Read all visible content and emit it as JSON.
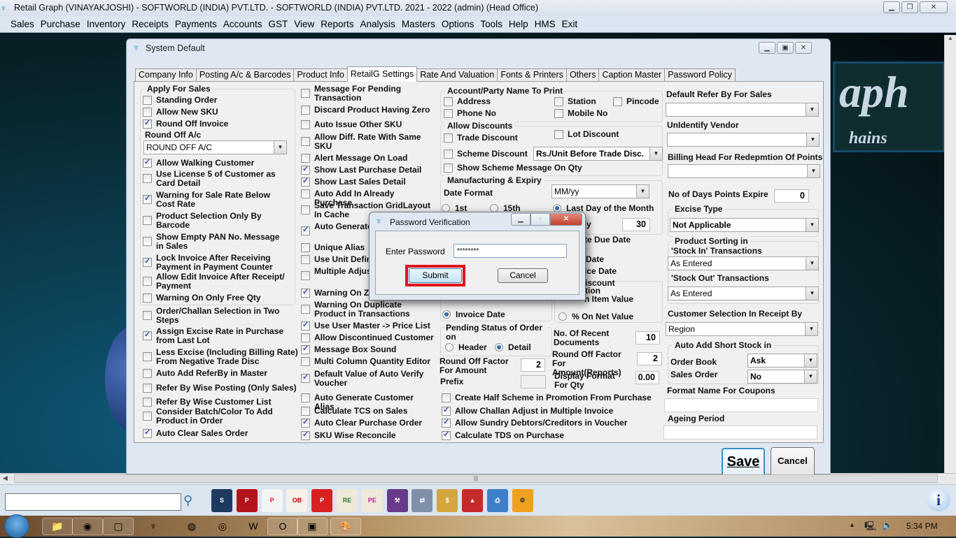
{
  "app": {
    "title": "Retail Graph (VINAYAKJOSHI) - SOFTWORLD (INDIA) PVT.LTD. - SOFTWORLD (INDIA) PVT.LTD.  2021 - 2022 (admin) (Head Office)"
  },
  "menu": [
    "Sales",
    "Purchase",
    "Inventory",
    "Receipts",
    "Payments",
    "Accounts",
    "GST",
    "View",
    "Reports",
    "Analysis",
    "Masters",
    "Options",
    "Tools",
    "Help",
    "HMS",
    "Exit"
  ],
  "background_logo": {
    "line1": "aph",
    "line2": "hains"
  },
  "window": {
    "title": "System Default",
    "tabs": [
      "Company Info",
      "Posting A/c & Barcodes",
      "Product Info",
      "RetailG Settings",
      "Rate And Valuation",
      "Fonts & Printers",
      "Others",
      "Caption Master",
      "Password Policy"
    ],
    "active_tab": "RetailG Settings"
  },
  "col1": {
    "group_title": "Apply For Sales",
    "items": [
      {
        "label": "Standing Order",
        "checked": false
      },
      {
        "label": "Allow New SKU",
        "checked": false
      },
      {
        "label": "Round Off Invoice",
        "checked": true
      }
    ],
    "round_off_label": "Round Off A/c",
    "round_off_value": "ROUND OFF A/C",
    "items2": [
      {
        "label": "Allow Walking Customer",
        "checked": true
      },
      {
        "label": "Use License 5 of Customer as Card Detail",
        "checked": false
      },
      {
        "label": "Warning for Sale Rate Below Cost Rate",
        "checked": true
      },
      {
        "label": "Product Selection Only By Barcode",
        "checked": false
      },
      {
        "label": "Show Empty PAN No. Message in Sales",
        "checked": false
      },
      {
        "label": "Lock Invoice After Receiving Payment in Payment Counter",
        "checked": true
      },
      {
        "label": "Allow Edit Invoice After Receipt/ Payment",
        "checked": false
      },
      {
        "label": "Warning On Only Free Qty",
        "checked": false
      }
    ],
    "items3": [
      {
        "label": "Order/Challan Selection in Two Steps",
        "checked": false
      },
      {
        "label": "Assign Excise Rate in Purchase from Last Lot",
        "checked": true
      },
      {
        "label": "Less Excise (Including Billing Rate) From Negative Trade Disc",
        "checked": false
      },
      {
        "label": "Auto Add ReferBy in Master",
        "checked": false
      },
      {
        "label": "Refer By Wise Posting (Only Sales)",
        "checked": false
      },
      {
        "label": "Refer By Wise Customer List",
        "checked": false
      },
      {
        "label": "Consider Batch/Color To Add Product in Order",
        "checked": false
      },
      {
        "label": "Auto Clear Sales Order",
        "checked": true
      }
    ]
  },
  "col2": {
    "items": [
      {
        "label": "Message For Pending Transaction",
        "checked": false
      },
      {
        "label": "Discard Product Having Zero",
        "checked": false
      },
      {
        "label": "Auto Issue Other SKU",
        "checked": false
      },
      {
        "label": "Allow Diff. Rate With Same SKU",
        "checked": false
      },
      {
        "label": "Alert Message On Load",
        "checked": false
      },
      {
        "label": "Show Last Purchase Detail",
        "checked": true
      },
      {
        "label": "Show Last Sales Detail",
        "checked": true
      },
      {
        "label": "Auto Add In Already Purchase",
        "checked": false
      },
      {
        "label": "Save Transaction GridLayout In Cache",
        "checked": false
      },
      {
        "label": "Auto Generate In Purchase",
        "checked": true
      },
      {
        "label": "Unique Alias",
        "checked": false
      },
      {
        "label": "Use Unit Defin",
        "checked": false
      },
      {
        "label": "Multiple Adjus Entry",
        "checked": false
      },
      {
        "label": "Warning On Z",
        "checked": true
      },
      {
        "label": "Warning On Duplicate Product in Transactions",
        "checked": false
      },
      {
        "label": "Use User Master -> Price List",
        "checked": true
      },
      {
        "label": "Allow Discontinued Customer",
        "checked": false
      },
      {
        "label": "Message Box Sound",
        "checked": true
      },
      {
        "label": "Multi Column Quantity Editor",
        "checked": false
      },
      {
        "label": "Default Value of Auto Verify Voucher",
        "checked": true
      },
      {
        "label": "Auto Generate Customer Alias",
        "checked": false
      },
      {
        "label": "Calculate TCS on Sales",
        "checked": false
      },
      {
        "label": "Auto Clear Purchase Order",
        "checked": true
      },
      {
        "label": "SKU Wise Reconcile",
        "checked": true
      }
    ]
  },
  "col3": {
    "party": {
      "title": "Account/Party Name To Print",
      "address": "Address",
      "station": "Station",
      "pincode": "Pincode",
      "phone": "Phone No",
      "mobile": "Mobile No"
    },
    "discounts": {
      "title": "Allow Discounts",
      "trade": "Trade Discount",
      "lot": "Lot Discount",
      "scheme": "Scheme Discount",
      "scheme_value": "Rs./Unit Before Trade Disc.",
      "show_scheme": "Show Scheme Message On Qty"
    },
    "mfg": {
      "title": "Manufacturing & Expiry",
      "date_format_label": "Date Format",
      "date_format_value": "MM/yy",
      "r1": "1st",
      "r2": "15th",
      "r3": "Last  Day of the Month",
      "days_value": "30",
      "days_label_partial": "y"
    },
    "due": {
      "title_partial": "te Due Date",
      "opt1_partial": "Date",
      "opt2_partial": "ice Date",
      "invoice_date": "Invoice Date"
    },
    "discount_calc": {
      "title_partial": "iscount",
      "sub_partial": "tion",
      "item_partial": "n Item Value",
      "net": "% On Net Value"
    },
    "pending": {
      "title": "Pending Status of Order on",
      "header": "Header",
      "detail": "Detail"
    },
    "recent_docs": {
      "label": "No. Of Recent Documents",
      "value": "10"
    },
    "roundoff_reports": {
      "label": "Round Off Factor For Amount(Reports)",
      "value": "2"
    },
    "roundoff_amount": {
      "label": "Round Off Factor For Amount",
      "value": "2"
    },
    "display_qty": {
      "label": "Display Format For Qty",
      "value": "0.00"
    },
    "prefix": {
      "label": "Prefix",
      "value": ""
    },
    "bottom": [
      {
        "label": "Create Half Scheme in Promotion From Purchase",
        "checked": false
      },
      {
        "label": "Allow Challan Adjust in Multiple Invoice",
        "checked": true
      },
      {
        "label": "Allow Sundry Debtors/Creditors in Voucher",
        "checked": true
      },
      {
        "label": "Calculate TDS on Purchase",
        "checked": true
      }
    ]
  },
  "col4": {
    "default_refer_label": "Default Refer By For Sales",
    "default_refer_value": "",
    "unidentify_label": "UnIdentify Vendor",
    "unidentify_value": "",
    "billing_head_label": "Billing Head For Redepmtion Of Points",
    "billing_head_value": "",
    "points_expire_label": "No of Days Points Expire",
    "points_expire_value": "0",
    "excise_label": "Excise Type",
    "excise_value": "Not Applicable",
    "sorting_title": "Product Sorting in",
    "stock_in_label": "'Stock In' Transactions",
    "stock_in_value": "As Entered",
    "stock_out_label": "'Stock Out' Transactions",
    "stock_out_value": "As Entered",
    "cust_sel_label": "Customer Selection In Receipt By",
    "cust_sel_value": "Region",
    "short_stock_title": "Auto Add Short Stock in",
    "order_book_label": "Order Book",
    "order_book_value": "Ask",
    "sales_order_label": "Sales Order",
    "sales_order_value": "No",
    "coupons_label": "Format Name For Coupons",
    "coupons_value": "",
    "ageing_label": "Ageing Period",
    "ageing_value": ""
  },
  "buttons": {
    "save": "Save",
    "cancel": "Cancel"
  },
  "dialog": {
    "title": "Password Verification",
    "prompt": "Enter Password",
    "password": "********",
    "submit": "Submit",
    "cancel": "Cancel",
    "highlight_color": "#e0141e"
  },
  "toolbar": {
    "search_value": "",
    "icons": [
      "sales-invoice",
      "purchase-invoice",
      "purchase-entry",
      "order-book",
      "product-catalog",
      "receipt-entry",
      "payment-entry",
      "stock-transfer",
      "cash-exchange",
      "cash-calculator",
      "recycle-shapes",
      "printer",
      "settings"
    ]
  },
  "taskbar": {
    "apps": [
      "file-explorer",
      "chrome",
      "office",
      "retail-graph",
      "firefox",
      "media",
      "wps",
      "opera",
      "photos",
      "paint"
    ],
    "clock": "5:34 PM"
  }
}
